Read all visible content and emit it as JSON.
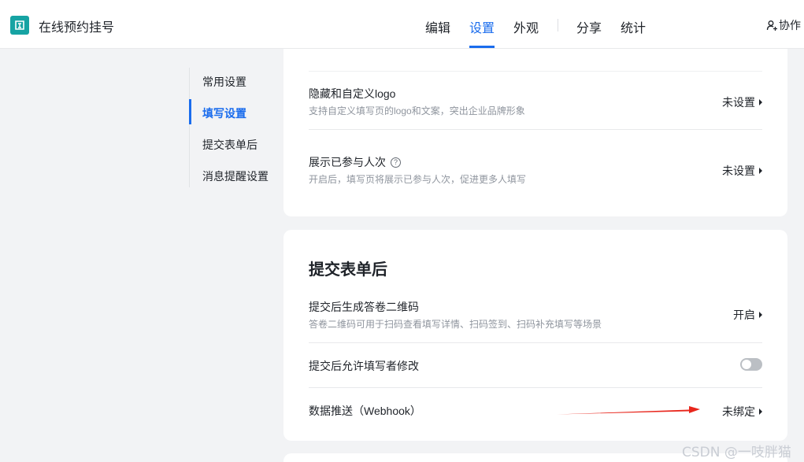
{
  "header": {
    "app_title": "在线预约挂号",
    "tabs": [
      {
        "label": "编辑",
        "active": false
      },
      {
        "label": "设置",
        "active": true
      },
      {
        "label": "外观",
        "active": false
      },
      {
        "label": "分享",
        "active": false
      },
      {
        "label": "统计",
        "active": false
      }
    ],
    "collab_label": "协作"
  },
  "sidebar": {
    "items": [
      {
        "label": "常用设置",
        "active": false
      },
      {
        "label": "填写设置",
        "active": true
      },
      {
        "label": "提交表单后",
        "active": false
      },
      {
        "label": "消息提醒设置",
        "active": false
      }
    ]
  },
  "fill_settings": {
    "rows": [
      {
        "title": "隐藏和自定义logo",
        "desc": "支持自定义填写页的logo和文案，突出企业品牌形象",
        "value": "未设置"
      },
      {
        "title": "展示已参与人次",
        "desc": "开启后，填写页将展示已参与人次，促进更多人填写",
        "value": "未设置",
        "help": "?"
      }
    ]
  },
  "after_submit": {
    "title": "提交表单后",
    "rows": [
      {
        "title": "提交后生成答卷二维码",
        "desc": "答卷二维码可用于扫码查看填写详情、扫码签到、扫码补充填写等场景",
        "value": "开启"
      },
      {
        "title": "提交后允许填写者修改",
        "toggle_on": false
      },
      {
        "title": "数据推送（Webhook）",
        "value": "未绑定"
      }
    ]
  },
  "watermark": "CSDN @一吱胖猫",
  "colors": {
    "accent": "#1a6ced",
    "brand": "#16a3a3",
    "annotation": "#e8261c"
  }
}
